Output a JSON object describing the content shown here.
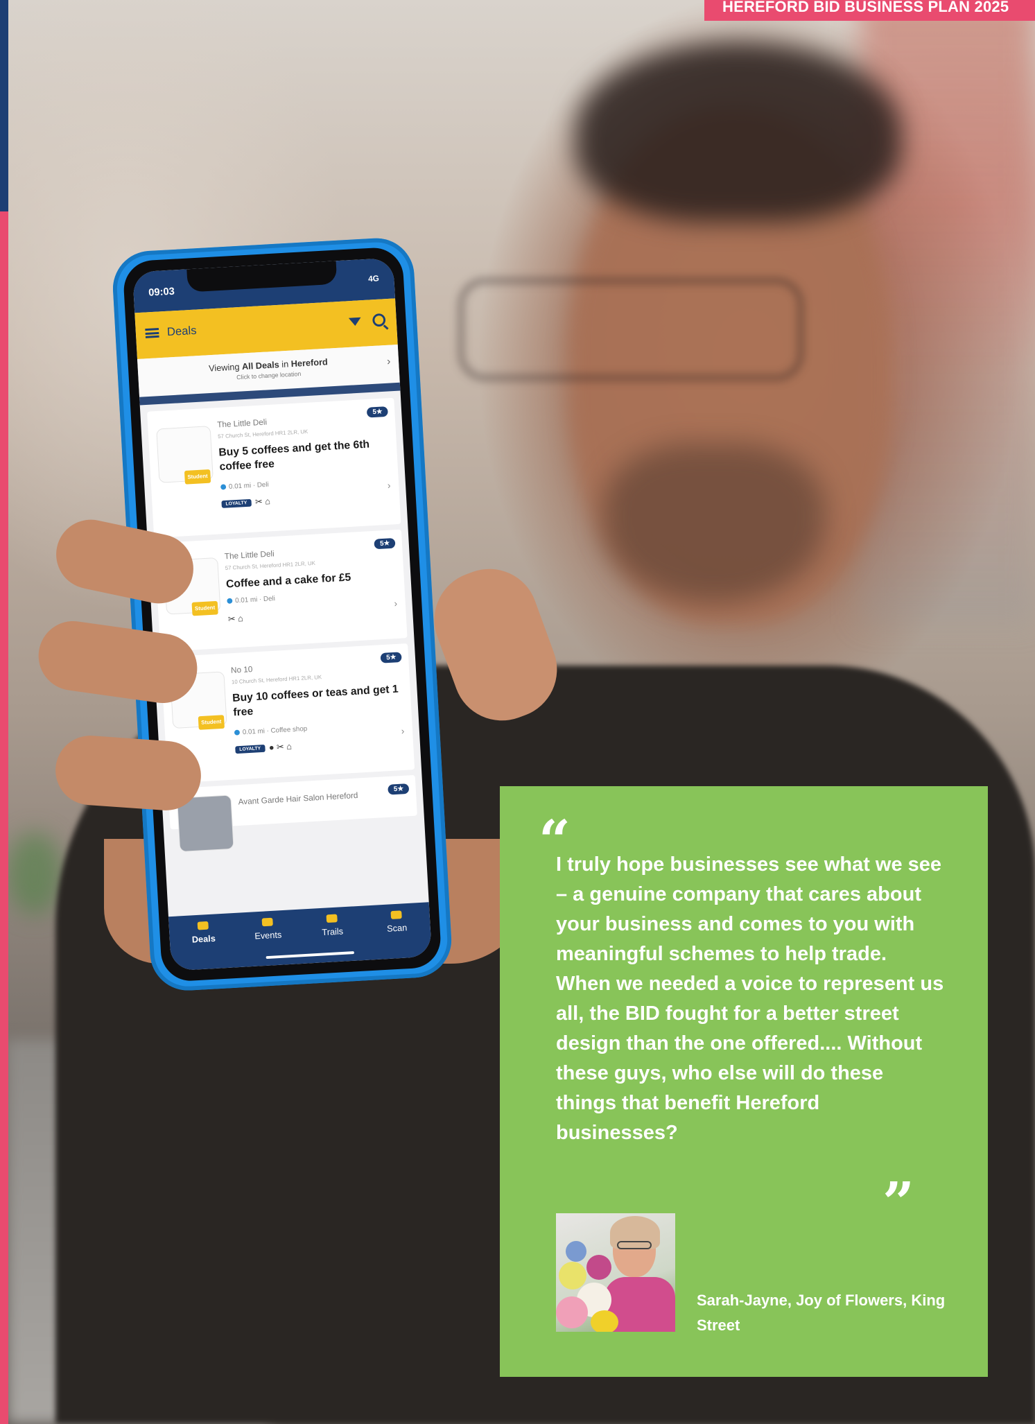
{
  "header": {
    "banner": "HEREFORD BID BUSINESS PLAN 2025"
  },
  "phone": {
    "status_time": "09:03",
    "status_right": "4G",
    "app_title": "Deals",
    "location_prefix": "Viewing ",
    "location_bold_1": "All Deals",
    "location_mid": " in ",
    "location_bold_2": "Hereford",
    "location_sub": "Click to change location",
    "deals": [
      {
        "merchant": "The Little Deli",
        "address": "57 Church St, Hereford HR1 2LR, UK",
        "title": "Buy 5 coffees and get the 6th coffee free",
        "meta": "0.01 mi · Deli",
        "badge": "5★",
        "tag": "Student",
        "loyalty": "LOYALTY",
        "icons": "✂ ⌂"
      },
      {
        "merchant": "The Little Deli",
        "address": "57 Church St, Hereford HR1 2LR, UK",
        "title": "Coffee and a cake for £5",
        "meta": "0.01 mi · Deli",
        "badge": "5★",
        "tag": "Student",
        "icons": "✂ ⌂"
      },
      {
        "merchant": "No 10",
        "address": "10 Church St, Hereford HR1 2LR, UK",
        "title": "Buy 10 coffees or teas and get 1 free",
        "meta": "0.01 mi · Coffee shop",
        "badge": "5★",
        "tag": "Student",
        "loyalty": "LOYALTY",
        "icons": "● ✂ ⌂"
      },
      {
        "merchant": "Avant Garde Hair Salon Hereford",
        "badge": "5★"
      }
    ],
    "tabs": [
      "Deals",
      "Events",
      "Trails",
      "Scan"
    ]
  },
  "quote": {
    "open_mark": "“",
    "text": "I truly hope businesses see what we see – a genuine company that cares about your business and comes to you with meaningful schemes to help trade. When we needed a voice to represent us all, the BID fought for a better street design than the one offered.... Without these guys, who else will do these things that benefit Hereford businesses?",
    "close_mark": "”",
    "attribution": "Sarah-Jayne, Joy of Flowers, King Street"
  },
  "colors": {
    "pink": "#e94b6f",
    "navy": "#1d3f74",
    "green": "#88c459",
    "app_yellow": "#f3c022",
    "case_blue": "#1f8fe6"
  }
}
